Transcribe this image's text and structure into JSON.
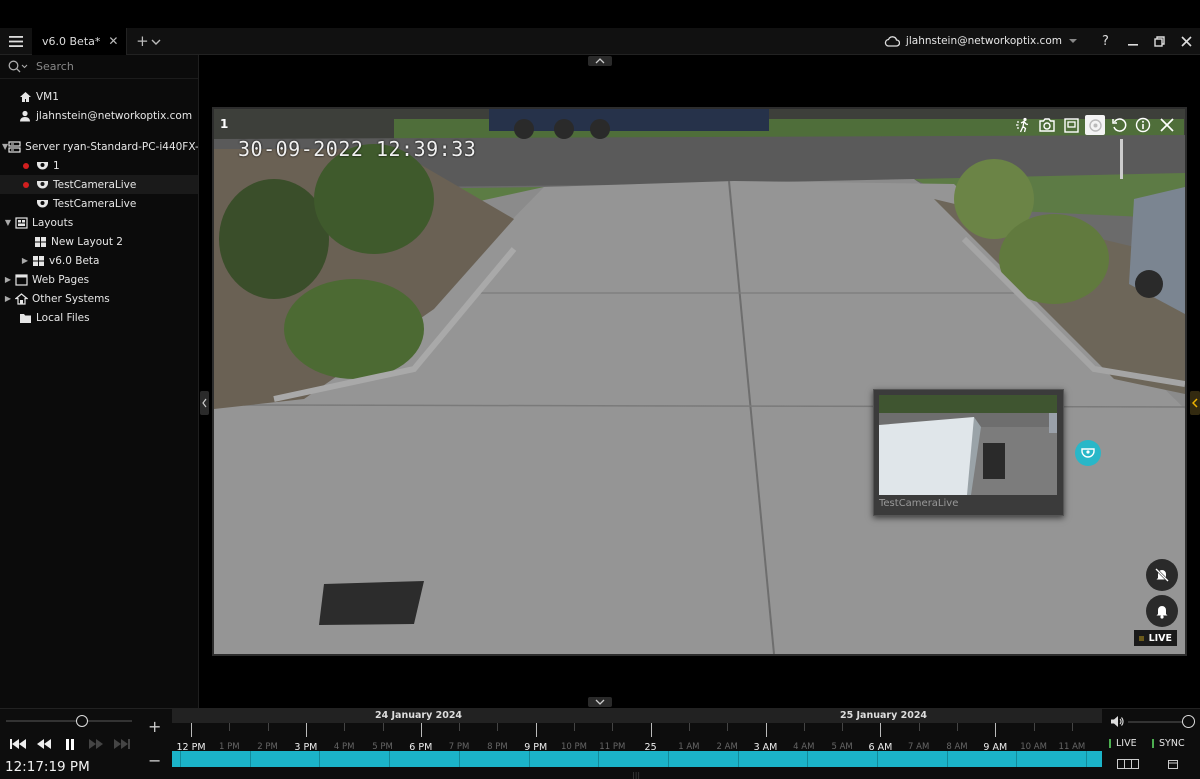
{
  "tabbar": {
    "tab_label": "v6.0 Beta*",
    "account": "jlahnstein@networkoptix.com"
  },
  "sidebar": {
    "search_placeholder": "Search",
    "items": [
      {
        "label": "VM1",
        "icon": "home-icon"
      },
      {
        "label": "jlahnstein@networkoptix.com",
        "icon": "user-icon"
      },
      {
        "label": "Server ryan-Standard-PC-i440FX-...",
        "icon": "server-icon"
      },
      {
        "label": "1",
        "icon": "camera-icon",
        "recording": true
      },
      {
        "label": "TestCameraLive",
        "icon": "camera-icon",
        "recording": true
      },
      {
        "label": "TestCameraLive",
        "icon": "camera-icon",
        "recording": false
      },
      {
        "label": "Layouts",
        "icon": "layouts-icon"
      },
      {
        "label": "New Layout 2",
        "icon": "layout-icon"
      },
      {
        "label": "v6.0 Beta",
        "icon": "layout-icon"
      },
      {
        "label": "Web Pages",
        "icon": "webpages-icon"
      },
      {
        "label": "Other Systems",
        "icon": "systems-icon"
      },
      {
        "label": "Local Files",
        "icon": "folder-icon"
      }
    ]
  },
  "camera": {
    "id": "1",
    "timestamp": "30-09-2022 12:39:33",
    "live_label": "LIVE",
    "popup_label": "TestCameraLive"
  },
  "timeline": {
    "current_time": "12:17:19 PM",
    "dates": [
      "24 January 2024",
      "25 January 2024"
    ],
    "ticks": [
      {
        "label": "12 PM",
        "major": true
      },
      {
        "label": "1 PM",
        "major": false
      },
      {
        "label": "2 PM",
        "major": false
      },
      {
        "label": "3 PM",
        "major": true
      },
      {
        "label": "4 PM",
        "major": false
      },
      {
        "label": "5 PM",
        "major": false
      },
      {
        "label": "6 PM",
        "major": true
      },
      {
        "label": "7 PM",
        "major": false
      },
      {
        "label": "8 PM",
        "major": false
      },
      {
        "label": "9 PM",
        "major": true
      },
      {
        "label": "10 PM",
        "major": false
      },
      {
        "label": "11 PM",
        "major": false
      },
      {
        "label": "25",
        "major": true
      },
      {
        "label": "1 AM",
        "major": false
      },
      {
        "label": "2 AM",
        "major": false
      },
      {
        "label": "3 AM",
        "major": true
      },
      {
        "label": "4 AM",
        "major": false
      },
      {
        "label": "5 AM",
        "major": false
      },
      {
        "label": "6 AM",
        "major": true
      },
      {
        "label": "7 AM",
        "major": false
      },
      {
        "label": "8 AM",
        "major": false
      },
      {
        "label": "9 AM",
        "major": true
      },
      {
        "label": "10 AM",
        "major": false
      },
      {
        "label": "11 AM",
        "major": false
      }
    ],
    "live_btn": "LIVE",
    "sync_btn": "SYNC"
  },
  "colors": {
    "recording": "#1bb3c8",
    "accent_dot": "#d21f1f",
    "popup_pin": "#29b7c8"
  }
}
